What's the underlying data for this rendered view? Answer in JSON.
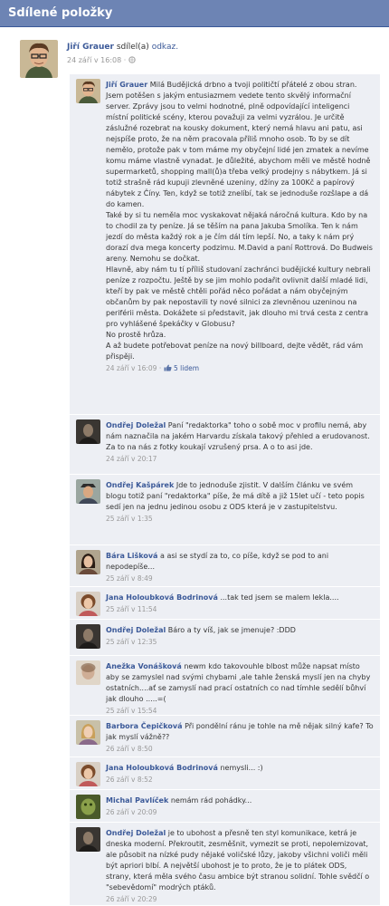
{
  "header": {
    "title": "Sdílené položky"
  },
  "post": {
    "author": "Jiří Grauer",
    "action_prefix": "sdílel(a)",
    "action_link": "odkaz.",
    "timestamp": "24 září v 16:08",
    "separator": "·"
  },
  "comments": [
    {
      "author": "Jiří Grauer",
      "avatar": "glasses-man",
      "text": "Milá Budějická drbno a tvoji političtí přátelé z obou stran. Jsem potěšen s jakým entusiazmem vedete tento skvělý informační server. Zprávy jsou to velmi hodnotné, plně odpovídající inteligenci místní politické scény, kterou považuji za velmi vyzrálou. Je určitě záslužné rozebrat na kousky dokument, který nemá hlavu ani patu, asi nejspíše proto, že na něm pracovala příliš mnoho osob. To by se dít nemělo, protože pak v tom máme my obyčejní lidé jen zmatek a nevíme komu máme vlastně vynadat. Je důležité, abychom měli ve městě hodně supermarketů, shopping mall(ů)a třeba velký prodejny s nábytkem. Já si totiž strašně rád kupuji zlevněné uzeniny, džíny za 100Kč a papírový nábytek z Číny. Ten, když se totiž znelíbí, tak se jednoduše rozšlape a dá do kamen.",
      "text2": "Také by si tu neměla moc vyskakovat nějaká náročná kultura. Kdo by na to chodil za ty peníze. Já se těším na pana Jakuba Smolíka. Ten k nám jezdí do města každý rok a je čím dál tím lepší. No, a taky k nám prý dorazí dva mega koncerty podzimu. M.David a paní Rottrová. Do Budweis areny. Nemohu se dočkat.",
      "text3": "Hlavně, aby nám tu tí příliš studovaní zachránci budějické kultury nebrali peníze z rozpočtu. Ještě by se jim mohlo podařit ovlivnit další mladé lidi, kteří by pak ve městě chtěli pořád něco pořádat a nám obyčejným občanům by pak nepostavili ty nové silnici za zlevněnou uzeninou na periférii města. Dokážete si představit, jak dlouho mi trvá cesta z centra pro vyhlášené špekáčky v Globusu?",
      "text4": "No prostě hrůza.",
      "text5": "A až budete potřebovat peníze na nový billboard, dejte vědět, rád vám přispěji.",
      "time": "24 září v 16:09",
      "likes": "5 lidem"
    },
    {
      "author": "Ondřej Doležal",
      "avatar": "dark-portrait",
      "text": "Paní \"redaktorka\" toho o sobě moc v profilu nemá, aby nám naznačila na jakém Harvardu získala takový přehled a erudovanost. Za to na nás z fotky koukají vzrušený prsa. A o to asi jde.",
      "time": "24 září v 20:17"
    },
    {
      "author": "Ondřej Kašpárek",
      "avatar": "man-with-hat",
      "text": "Jde to jednoduše zjistit. V dalším článku ve svém blogu totiž paní \"redaktorka\" píše, že má dítě a již 15let učí - teto popis sedí jen na jednu jedinou osobu z ODS která je v zastupitelstvu.",
      "time": "25 září v 1:35"
    },
    {
      "author": "Bára Lišková",
      "avatar": "woman-dark-hair",
      "text": "a asi se stydí za to, co píše, když se pod to ani nepodepíše...",
      "time": "25 září v 8:49"
    },
    {
      "author": "Jana Holoubková Bodrinová",
      "avatar": "woman-curly",
      "text": "...tak ted jsem se malem lekla....",
      "time": "25 září v 11:54"
    },
    {
      "author": "Ondřej Doležal",
      "avatar": "dark-portrait",
      "text": "Báro a ty víš, jak se jmenuje? :DDD",
      "time": "25 září v 12:35"
    },
    {
      "author": "Anežka Vonášková",
      "avatar": "blurry-face",
      "text": "newm kdo takovouhle blbost může napsat místo aby se zamyslel nad svými chybami ,ale tahle ženská myslí jen na chyby ostatních....ať se zamyslí nad prací ostatních co nad tímhle sedělí bůhví jak dlouho .....=(",
      "time": "25 září v 15:54"
    },
    {
      "author": "Barbora Čepičková",
      "avatar": "woman-blonde",
      "text": "Při pondělní ránu je tohle na mě nějak silný kafe? To jak myslí vážně??",
      "time": "26 září v 8:50"
    },
    {
      "author": "Jana Holoubková Bodrinová",
      "avatar": "woman-curly",
      "text": "nemysli... :)",
      "time": "26 září v 8:52"
    },
    {
      "author": "Michal Pavlíček",
      "avatar": "green-face",
      "text": "nemám rád pohádky...",
      "time": "26 září v 20:09"
    },
    {
      "author": "Ondřej Doležal",
      "avatar": "dark-portrait",
      "text": "je to ubohost a přesně ten styl komunikace, ketrá je dneska moderní. Překroutit, zesměšnit, vymezit se proti, nepolemizovat, ale působit na nízké pudy nějaké voličské lůzy, jakoby všichni voliči měli být apriori blbí. A největší ubohost je to proto, že je to plátek ODS, strany, která měla svého času ambice být stranou solidní. Tohle svědčí o \"sebevědomí\" modrých ptáků.",
      "time": "26 září v 20:29"
    }
  ]
}
